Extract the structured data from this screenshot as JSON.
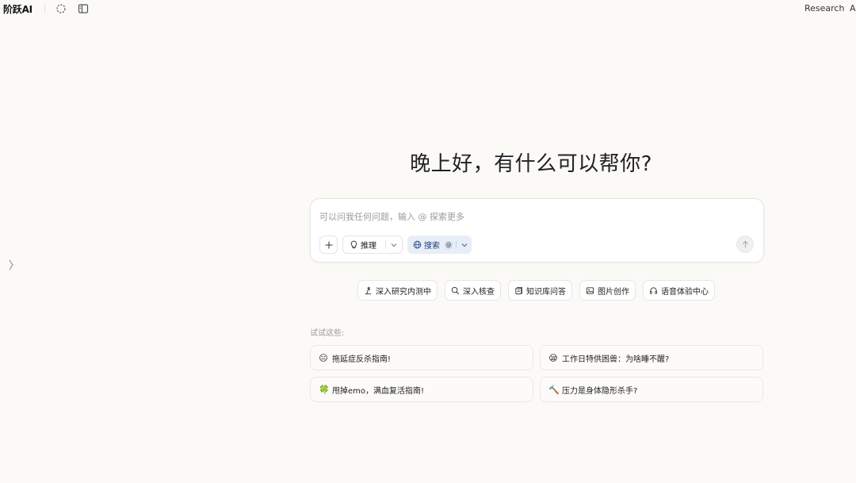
{
  "app": {
    "brand": "阶跃AI"
  },
  "topbar": {
    "links": [
      "Research",
      "A"
    ]
  },
  "greeting": "晚上好，有什么可以帮你?",
  "composer": {
    "placeholder": "可以问我任何问题，输入 @ 探索更多",
    "reason_label": "推理",
    "search_label": "搜索",
    "search_badge": "@"
  },
  "chips": [
    {
      "icon": "research-icon",
      "label": "深入研究内测中"
    },
    {
      "icon": "magnifier-icon",
      "label": "深入核查"
    },
    {
      "icon": "knowledge-base-icon",
      "label": "知识库问答"
    },
    {
      "icon": "image-icon",
      "label": "图片创作"
    },
    {
      "icon": "headphones-icon",
      "label": "语音体验中心"
    }
  ],
  "suggestions": {
    "title": "试试这些:",
    "items": [
      {
        "emoji": "😑",
        "label": "拖延症反杀指南!"
      },
      {
        "emoji": "😪",
        "label": "工作日特供困兽：为啥睡不醒?"
      },
      {
        "emoji": "🍀",
        "label": "甩掉emo，满血复活指南!"
      },
      {
        "emoji": "🔨",
        "label": "压力是身体隐形杀手?"
      }
    ]
  },
  "colors": {
    "background": "#fbfaf7",
    "search_active_bg": "#e8eef8",
    "search_active_text": "#1d3b72"
  }
}
